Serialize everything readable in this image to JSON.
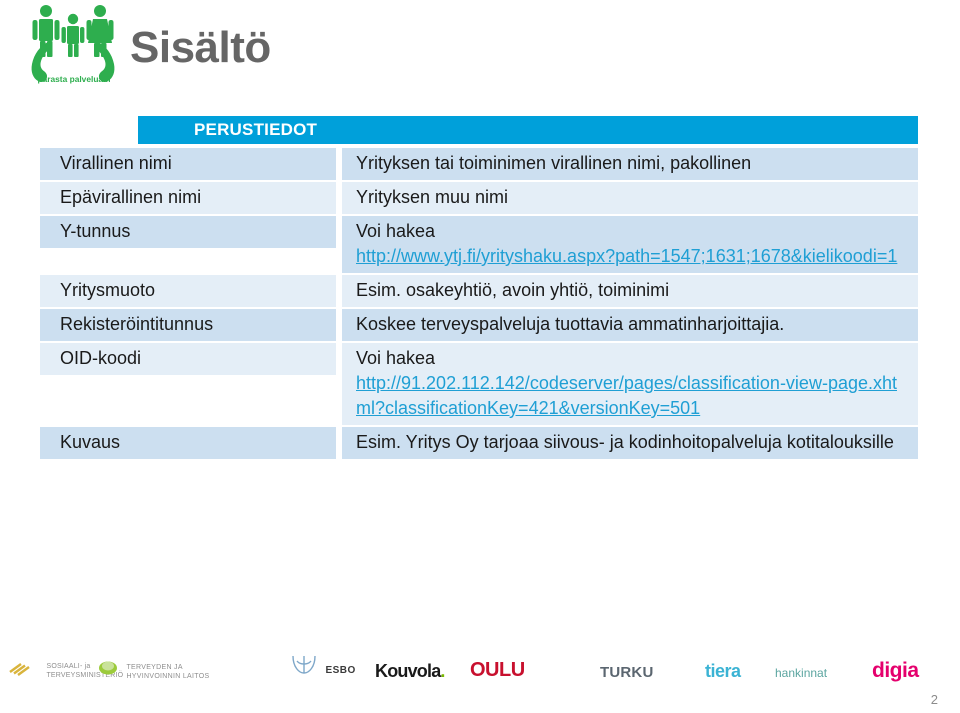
{
  "slide": {
    "title": "Sisältö",
    "page_number": "2",
    "brand": {
      "logo_name": "parasta-palvelua-logo",
      "tagline": "parasta palvelua.fi",
      "color": "#2eae4e"
    }
  },
  "table": {
    "header": "PERUSTIEDOT",
    "header_color": "#00a0da",
    "row_color_a": "#ccdff0",
    "row_color_b": "#e4eef7",
    "link_color": "#1f9fd4",
    "rows": [
      {
        "label": "Virallinen nimi",
        "lead": "Yrityksen tai toiminimen virallinen nimi, pakollinen",
        "link": "",
        "extra": ""
      },
      {
        "label": "Epävirallinen nimi",
        "lead": "Yrityksen muu nimi",
        "link": "",
        "extra": ""
      },
      {
        "label": "Y-tunnus",
        "lead": "Voi hakea",
        "link": "http://www.ytj.fi/yrityshaku.aspx?path=1547;1631;1678&kielikoodi=1",
        "extra": ""
      },
      {
        "label": "Yritysmuoto",
        "lead": "Esim. osakeyhtiö, avoin yhtiö, toiminimi",
        "link": "",
        "extra": ""
      },
      {
        "label": "Rekisteröintitunnus",
        "lead": "Koskee terveyspalveluja tuottavia ammatinharjoittajia.",
        "link": "",
        "extra": ""
      },
      {
        "label": "OID-koodi",
        "lead": "Voi hakea",
        "link": "http://91.202.112.142/codeserver/pages/classification-view-page.xhtml?classificationKey=421&versionKey=501",
        "extra": ""
      },
      {
        "label": "Kuvaus",
        "lead": "Esim. Yritys Oy tarjoaa siivous- ja kodinhoitopalveluja kotitalouksille",
        "link": "",
        "extra": ""
      }
    ]
  },
  "footer": {
    "logos": [
      {
        "name": "sosiaali-ja-terveysministerio-logo",
        "line1": "SOSIAALI- ja",
        "line2": "TERVEYSMINISTERIÖ"
      },
      {
        "name": "thl-logo",
        "line1": "TERVEYDEN JA",
        "line2": "HYVINVOINNIN LAITOS"
      },
      {
        "name": "espoo-logo",
        "label": "ESBO"
      },
      {
        "name": "kouvola-logo",
        "label": "Kouvola"
      },
      {
        "name": "oulu-logo",
        "label": "OULU"
      },
      {
        "name": "turku-logo",
        "label": "TURKU"
      },
      {
        "name": "tiera-logo",
        "label": "tiera"
      },
      {
        "name": "hankinnat-logo",
        "label": "hankinnat"
      },
      {
        "name": "digia-logo",
        "label": "digia"
      }
    ]
  }
}
